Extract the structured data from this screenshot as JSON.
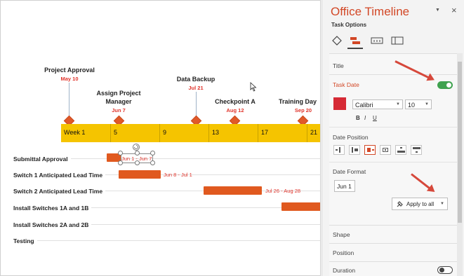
{
  "colors": {
    "accent": "#d24726",
    "bar": "#e0591f",
    "timescale": "#f5c400",
    "milestone_date": "#e0332a",
    "toggle_on": "#3fa24f",
    "date_color_swatch": "#d62a35"
  },
  "slide": {
    "milestones": [
      {
        "title": "Project Approval",
        "date": "May 10"
      },
      {
        "title": "Assign Project\nManager",
        "date": "Jun 7"
      },
      {
        "title": "Data Backup",
        "date": "Jul 21"
      },
      {
        "title": "Checkpoint A",
        "date": "Aug 12"
      },
      {
        "title": "Training Day",
        "date": "Sep 20"
      }
    ],
    "timescale_labels": [
      "Week 1",
      "5",
      "9",
      "13",
      "17",
      "21"
    ],
    "tasks": [
      {
        "name": "Submittal Approval",
        "date": "Jun 1 - Jun 7"
      },
      {
        "name": "Switch 1 Anticipated Lead Time",
        "date": "Jun 8 - Jul 1"
      },
      {
        "name": "Switch 2 Anticipated Lead Time",
        "date": "Jul 26 - Aug 28"
      },
      {
        "name": "Install Switches 1A and 1B",
        "date": ""
      },
      {
        "name": "Install Switches 2A and 2B",
        "date": ""
      },
      {
        "name": "Testing",
        "date": ""
      }
    ]
  },
  "pane": {
    "title": "Office Timeline",
    "dropdown_icon": "chevron-down-icon",
    "close_label": "×",
    "section_header": "Task Options",
    "tabs": [
      "diamond-icon",
      "task-bar-icon",
      "timescale-icon",
      "swimlane-icon"
    ],
    "title_section": "Title",
    "task_date": {
      "label": "Task Date",
      "toggle_on": true
    },
    "font": {
      "family": "Calibri",
      "size": "10",
      "bold": "B",
      "italic": "I",
      "underline": "U"
    },
    "date_position": {
      "label": "Date Position",
      "options": 6,
      "selected_index": 2
    },
    "date_format": {
      "label": "Date Format",
      "value": "Jun 1"
    },
    "apply_all": "Apply to all",
    "shape": "Shape",
    "position": "Position",
    "duration": {
      "label": "Duration",
      "toggle_on": false
    }
  }
}
